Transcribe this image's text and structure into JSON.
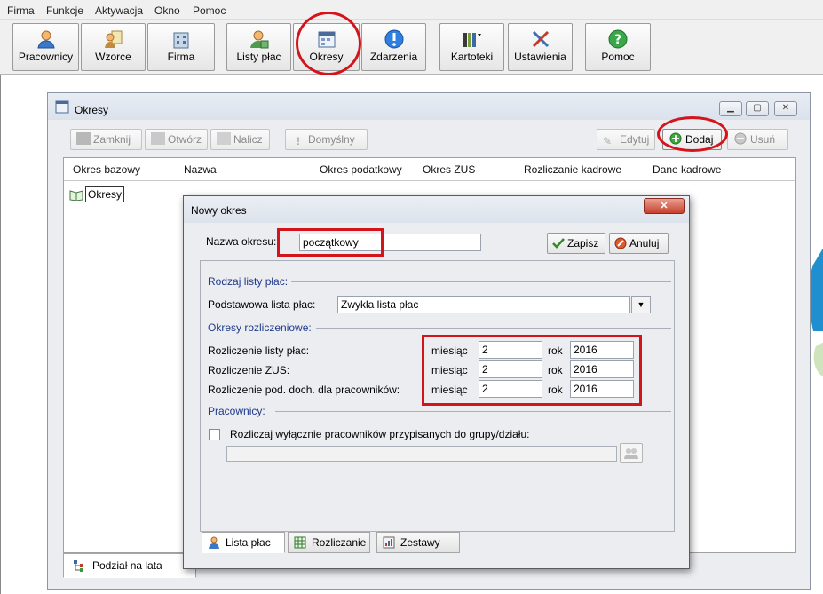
{
  "menu": [
    "Firma",
    "Funkcje",
    "Aktywacja",
    "Okno",
    "Pomoc"
  ],
  "toolbar": {
    "buttons": [
      {
        "label": "Pracownicy",
        "icon": "person-icon"
      },
      {
        "label": "Wzorce",
        "icon": "templates-icon"
      },
      {
        "label": "Firma",
        "icon": "company-icon"
      },
      {
        "label": "Listy płac",
        "icon": "payroll-icon"
      },
      {
        "label": "Okresy",
        "icon": "periods-icon"
      },
      {
        "label": "Zdarzenia",
        "icon": "info-icon"
      },
      {
        "label": "Kartoteki",
        "icon": "binders-icon"
      },
      {
        "label": "Ustawienia",
        "icon": "tools-icon"
      },
      {
        "label": "Pomoc",
        "icon": "help-icon"
      }
    ]
  },
  "okresy_window": {
    "title": "Okresy",
    "buttons": {
      "zamknij": "Zamknij",
      "otworz": "Otwórz",
      "nalicz": "Nalicz",
      "domyslny": "Domyślny",
      "edytuj": "Edytuj",
      "dodaj": "Dodaj",
      "usun": "Usuń"
    },
    "columns": [
      "Okres bazowy",
      "Nazwa",
      "Okres podatkowy",
      "Okres ZUS",
      "Rozliczanie kadrowe",
      "Dane kadrowe"
    ],
    "tree_root": "Okresy",
    "bottom_tab": "Podział na lata"
  },
  "dialog": {
    "title": "Nowy okres",
    "name_label": "Nazwa okresu:",
    "name_value": "początkowy",
    "save": "Zapisz",
    "cancel": "Anuluj",
    "section_payroll_type": "Rodzaj listy płac:",
    "base_payroll_label": "Podstawowa lista płac:",
    "base_payroll_value": "Zwykła lista płac",
    "section_periods": "Okresy rozliczeniowe:",
    "rows": [
      {
        "label": "Rozliczenie listy płac:",
        "month_label": "miesiąc",
        "month": "2",
        "year_label": "rok",
        "year": "2016"
      },
      {
        "label": "Rozliczenie ZUS:",
        "month_label": "miesiąc",
        "month": "2",
        "year_label": "rok",
        "year": "2016"
      },
      {
        "label": "Rozliczenie pod. doch. dla pracowników:",
        "month_label": "miesiąc",
        "month": "2",
        "year_label": "rok",
        "year": "2016"
      }
    ],
    "section_employees": "Pracownicy:",
    "checkbox_label": "Rozliczaj wyłącznie pracowników przypisanych do grupy/działu:",
    "tabs": [
      "Lista płac",
      "Rozliczanie",
      "Zestawy"
    ]
  },
  "colors": {
    "highlight": "#d3141b",
    "section_text": "#1f3a8a"
  }
}
